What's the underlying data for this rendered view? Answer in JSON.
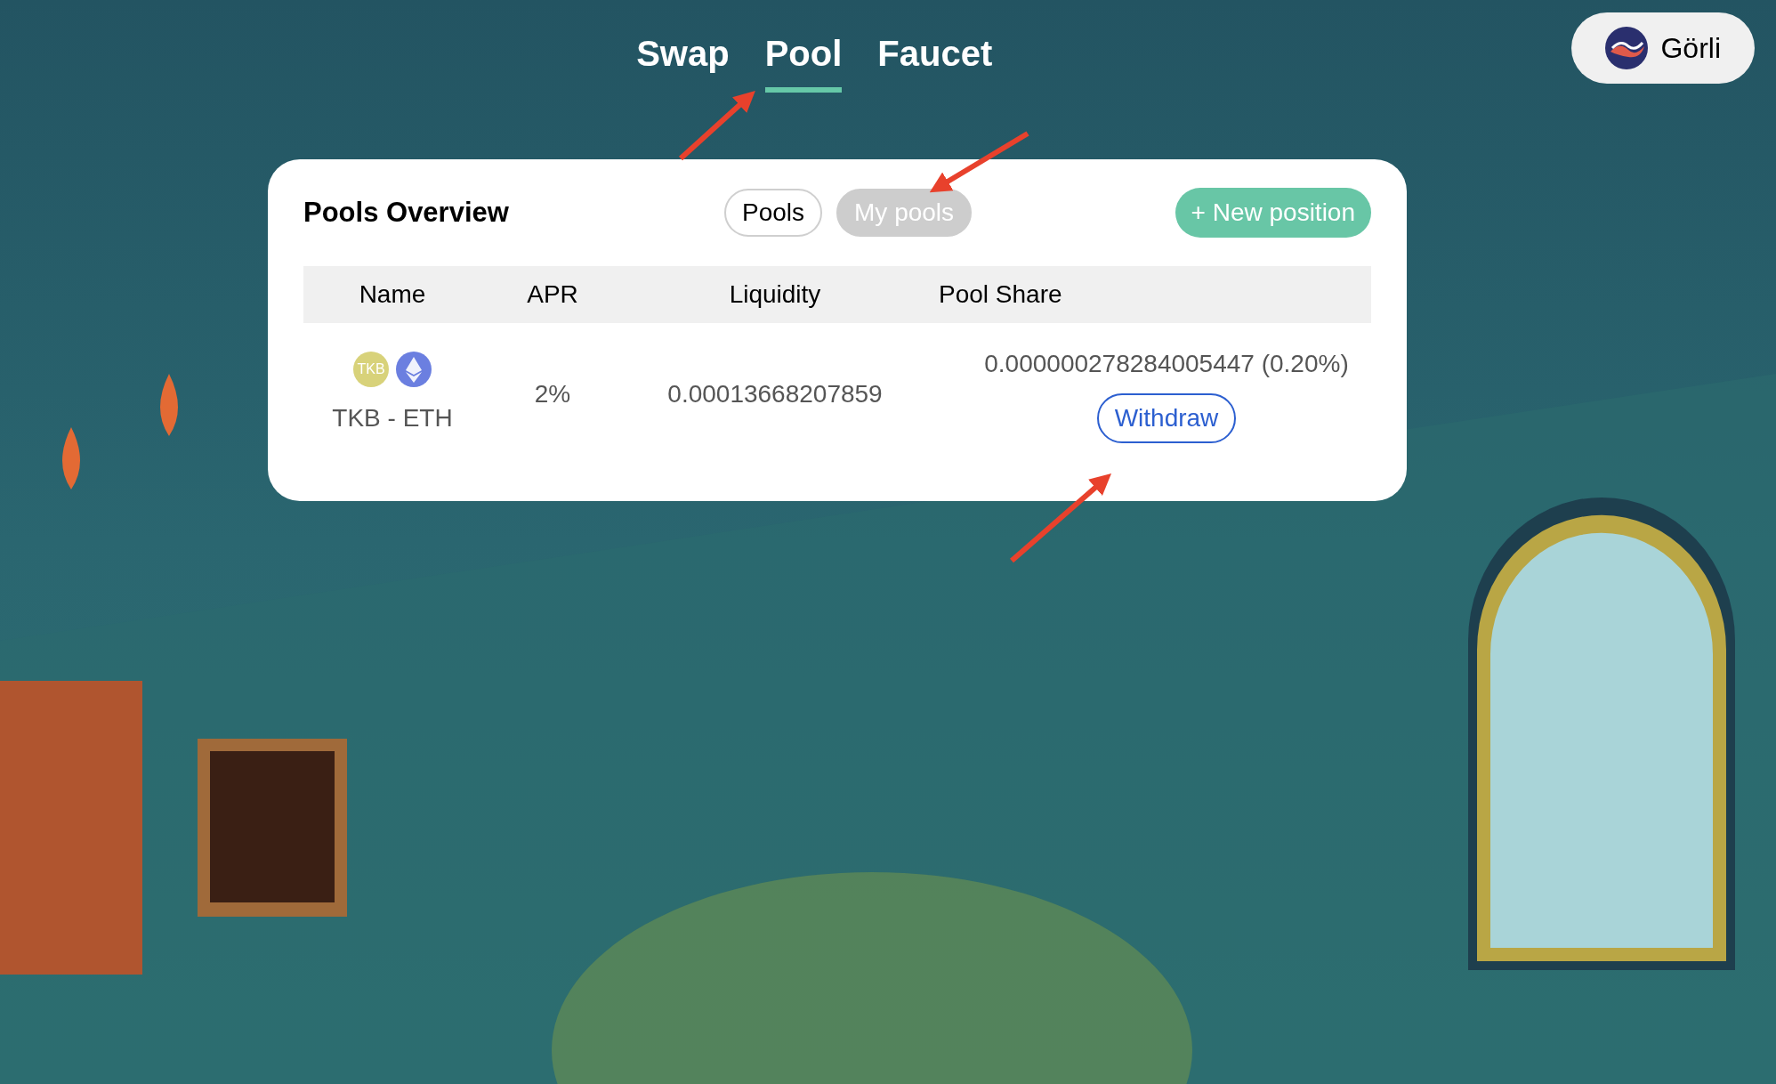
{
  "nav": {
    "tabs": [
      {
        "label": "Swap",
        "selected": false
      },
      {
        "label": "Pool",
        "selected": true
      },
      {
        "label": "Faucet",
        "selected": false
      }
    ]
  },
  "network": {
    "label": "Görli"
  },
  "pools_card": {
    "title": "Pools Overview",
    "filters": [
      {
        "label": "Pools",
        "selected": false
      },
      {
        "label": "My pools",
        "selected": true
      }
    ],
    "new_button": "+ New position",
    "columns": [
      "Name",
      "APR",
      "Liquidity",
      "Pool Share"
    ],
    "rows": [
      {
        "token_a": "TKB",
        "name": "TKB - ETH",
        "apr": "2%",
        "liquidity": "0.00013668207859",
        "pool_share": "0.000000278284005447 (0.20%)",
        "action": "Withdraw"
      }
    ]
  }
}
